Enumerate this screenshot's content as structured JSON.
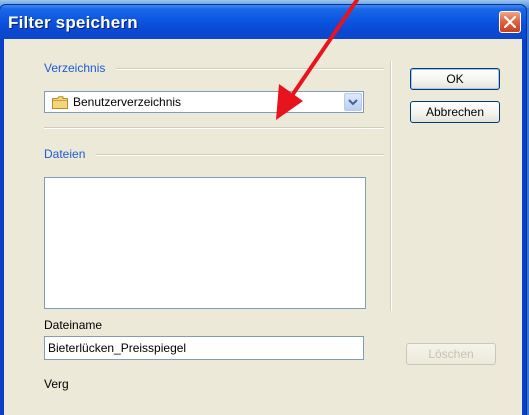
{
  "dialog": {
    "title": "Filter speichern",
    "close_icon": "close-x-icon"
  },
  "directory": {
    "group_label": "Verzeichnis",
    "selected_value": "Benutzerverzeichnis",
    "icon": "folder-icon"
  },
  "files": {
    "group_label": "Dateien",
    "items": []
  },
  "filename": {
    "label": "Dateiname",
    "value": "Bieterlücken_Preisspiegel"
  },
  "comparison": {
    "label": "Verg"
  },
  "buttons": {
    "ok": "OK",
    "cancel": "Abbrechen",
    "delete": "Löschen"
  },
  "annotation": {
    "type": "arrow",
    "color": "#e8141c"
  }
}
